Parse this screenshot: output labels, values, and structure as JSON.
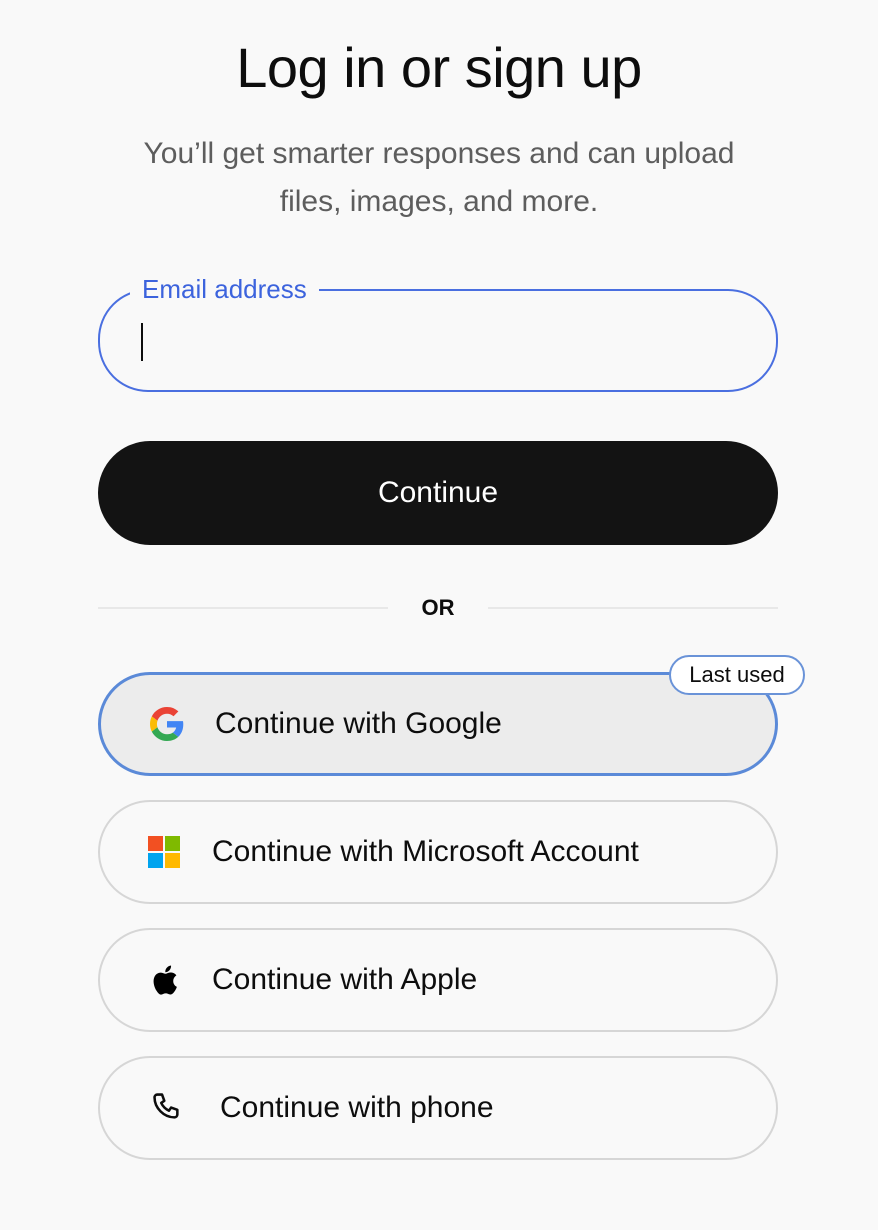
{
  "header": {
    "title": "Log in or sign up",
    "subtitle": "You’ll get smarter responses and can upload files, images, and more."
  },
  "email": {
    "label": "Email address",
    "value": "",
    "focused": true
  },
  "continue_button": {
    "label": "Continue"
  },
  "divider": {
    "label": "OR"
  },
  "oauth": {
    "google": {
      "label": "Continue with Google",
      "icon": "google-icon",
      "badge": "Last used"
    },
    "microsoft": {
      "label": "Continue with Microsoft Account",
      "icon": "microsoft-icon"
    },
    "apple": {
      "label": "Continue with Apple",
      "icon": "apple-icon"
    },
    "phone": {
      "label": "Continue with phone",
      "icon": "phone-icon"
    }
  },
  "colors": {
    "focus_accent": "#4a6fe0",
    "primary_button": "#131313",
    "background": "#f9f9f9",
    "last_used_border": "#5b8ad8"
  }
}
